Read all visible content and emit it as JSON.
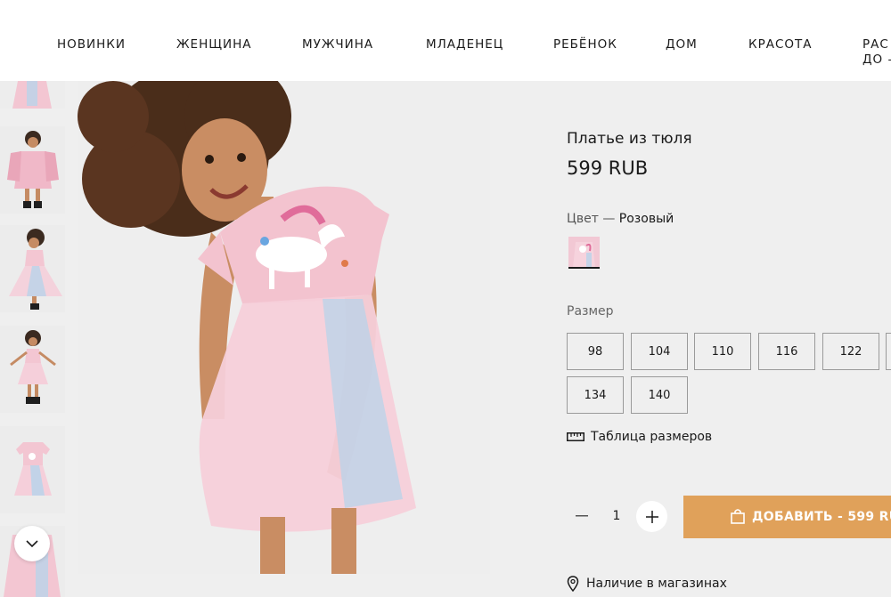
{
  "nav": {
    "items": [
      "НОВИНКИ",
      "ЖЕНЩИНА",
      "МУЖЧИНА",
      "МЛАДЕНЕЦ",
      "РЕБЁНОК",
      "ДОМ",
      "КРАСОТА"
    ],
    "partial_item_line1": "РАС",
    "partial_item_line2": "ДО -"
  },
  "gallery": {
    "thumbnail_icons": [
      "dress-photo-thumb",
      "child-jacket-photo-thumb",
      "child-twirl-photo-thumb",
      "child-full-photo-thumb",
      "dress-flatlay-thumb",
      "dress-detail-thumb"
    ],
    "scroll_icon": "chevron-down-icon",
    "main_image": "girl-in-pink-unicorn-tulle-dress-photo"
  },
  "product": {
    "title": "Платье из тюля",
    "price": "599 RUB",
    "color_prefix": "Цвет — ",
    "color_value": "Розовый",
    "size_label": "Размер",
    "sizes": [
      "98",
      "104",
      "110",
      "116",
      "122",
      "",
      "134",
      "140"
    ],
    "size_chart_label": "Таблица размеров",
    "quantity": "1",
    "add_to_cart_label": "ДОБАВИТЬ - 599 RU",
    "stores_label": "Наличие в магазинах"
  },
  "colors": {
    "accent": "#e0a15a",
    "swatch": "#f2c8d4",
    "page_bg": "#efefef",
    "nav_bg": "#ffffff"
  }
}
